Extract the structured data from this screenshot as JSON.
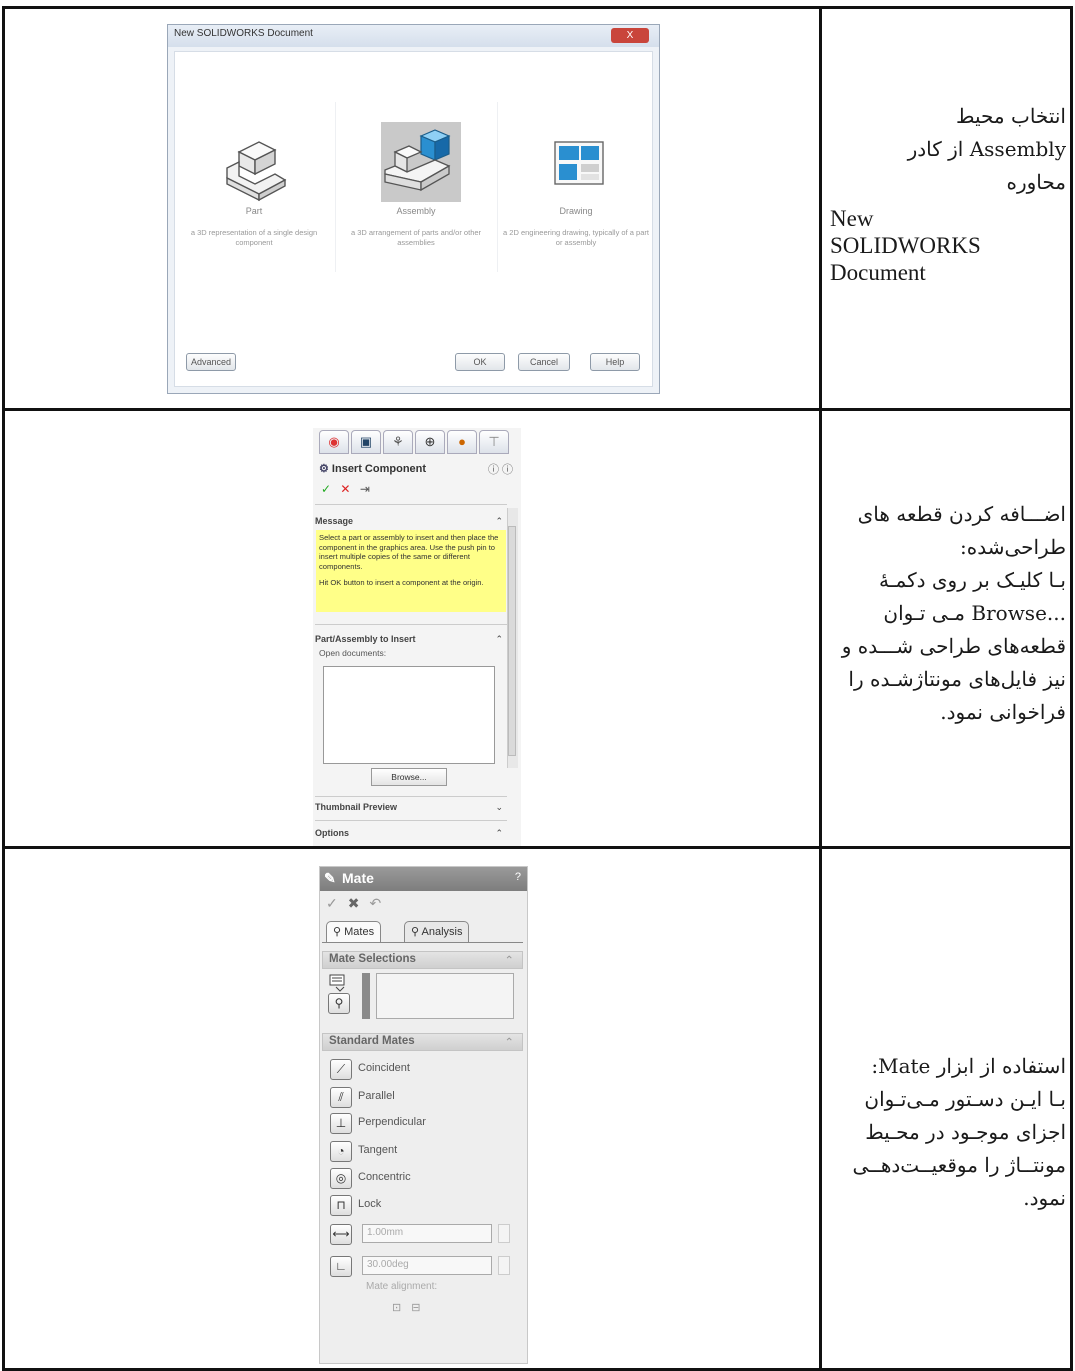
{
  "rows": [
    {
      "desc_lines": [
        "انتخاب محیط",
        "Assembly از کادر",
        "محاوره"
      ],
      "desc_en": [
        "New",
        "SOLIDWORKS",
        "Document"
      ]
    },
    {
      "desc_lines": [
        "اضـــافه کردن قطعه های",
        "طراحی‌شده:",
        "بـا کلیـک بر روی دکمـۀ",
        "...Browse مـی تـوان",
        "قطعه‌های طراحی شـــده و",
        "نیز فایل‌های مونتاژشـده را",
        "فراخوانی نمود."
      ]
    },
    {
      "desc_lines": [
        "استفاده از ابزار Mate:",
        "بـا ایـن دسـتور مـی‌تـوان",
        "اجزای موجـود در محـیط",
        "مونتــاژ را موقعیــت‌دهــی",
        "نمود."
      ]
    }
  ],
  "new_doc_dialog": {
    "title": "New SOLIDWORKS Document",
    "close_label": "X",
    "options": [
      {
        "name": "Part",
        "description": "a 3D representation of a single design component",
        "icon": "part-icon"
      },
      {
        "name": "Assembly",
        "description": "a 3D arrangement of parts and/or other assemblies",
        "icon": "assembly-icon",
        "selected": true
      },
      {
        "name": "Drawing",
        "description": "a 2D engineering drawing, typically of a part or assembly",
        "icon": "drawing-icon"
      }
    ],
    "buttons": {
      "advanced": "Advanced",
      "ok": "OK",
      "cancel": "Cancel",
      "help": "Help"
    }
  },
  "insert_component": {
    "title": "Insert Component",
    "help_icons": "ⓘ ⓘ",
    "actions": "✓ ✕ ⇥",
    "message_header": "Message",
    "message_p1": "Select a part or assembly to insert and then place the component in the graphics area. Use the push pin to insert multiple copies of the same or different components.",
    "message_p2": "Hit OK button to insert a component at the origin.",
    "part_header": "Part/Assembly to Insert",
    "open_documents_label": "Open documents:",
    "browse_label": "Browse...",
    "thumbnail_header": "Thumbnail Preview",
    "options_header": "Options"
  },
  "mate_panel": {
    "title": "Mate",
    "help": "?",
    "tabs": {
      "mates": "Mates",
      "analysis": "Analysis"
    },
    "selections_header": "Mate Selections",
    "standard_header": "Standard Mates",
    "mates": [
      "Coincident",
      "Parallel",
      "Perpendicular",
      "Tangent",
      "Concentric",
      "Lock"
    ],
    "distance_value": "1.00mm",
    "angle_value": "30.00deg",
    "alignment_label": "Mate alignment:"
  },
  "colors": {
    "message_bg": "#ffff88",
    "assembly_blue": "#2a8fd0",
    "border": "#111111"
  }
}
